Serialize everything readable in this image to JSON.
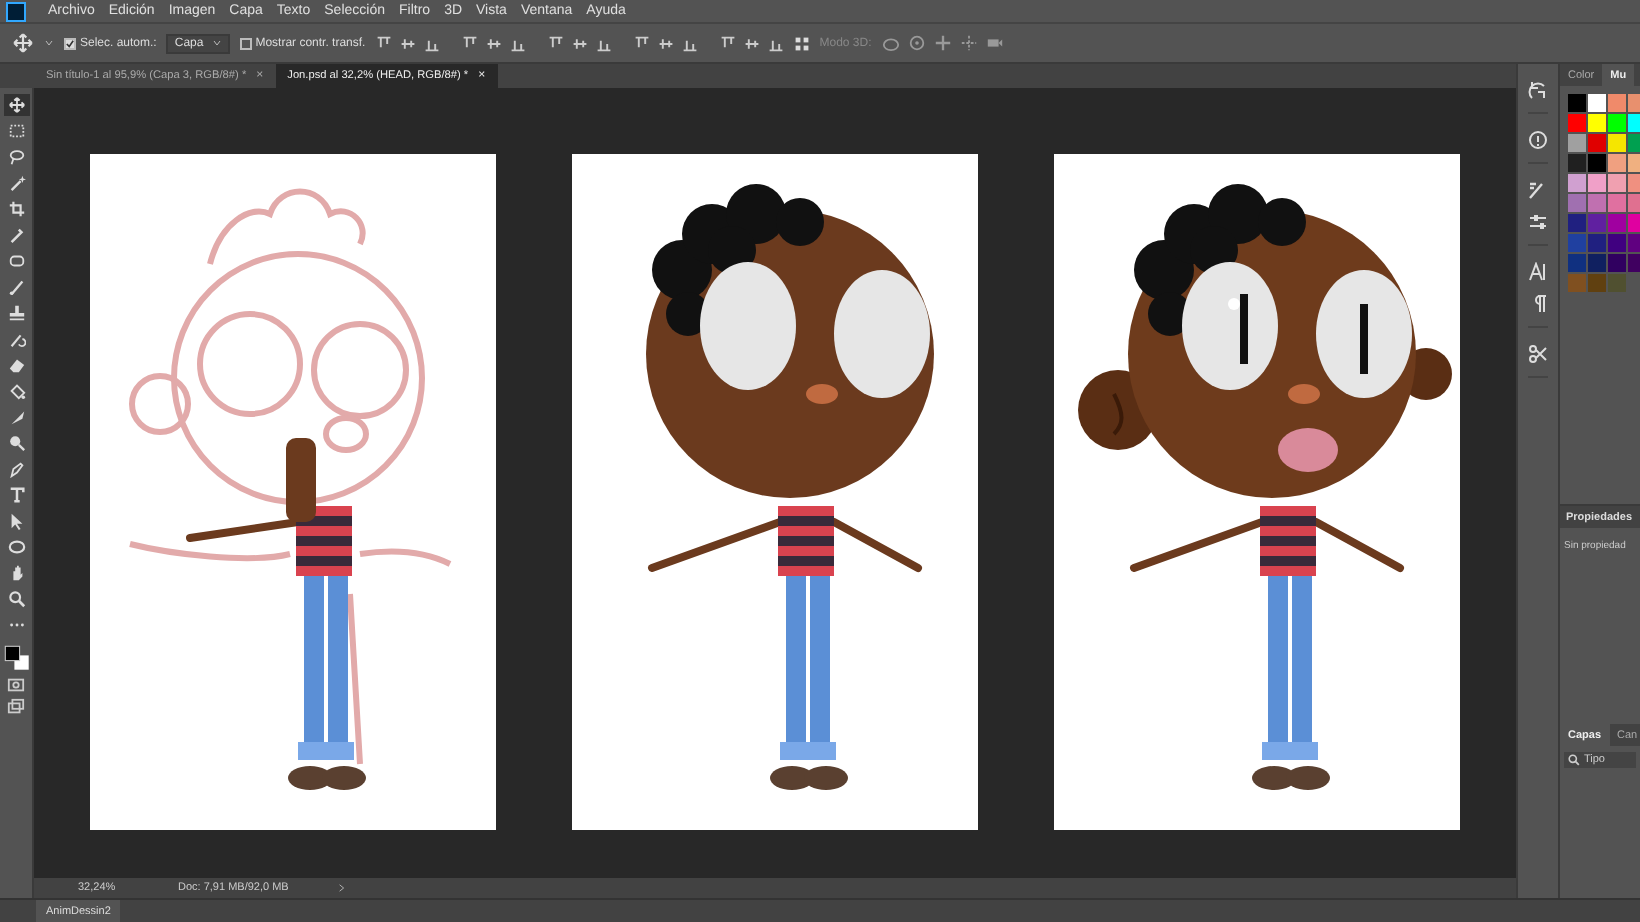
{
  "menu": {
    "items": [
      "Archivo",
      "Edición",
      "Imagen",
      "Capa",
      "Texto",
      "Selección",
      "Filtro",
      "3D",
      "Vista",
      "Ventana",
      "Ayuda"
    ]
  },
  "options_bar": {
    "auto_select": {
      "label": "Selec. autom.:",
      "checked": true
    },
    "target": {
      "value": "Capa"
    },
    "show_transform": {
      "label": "Mostrar contr. transf.",
      "checked": false
    },
    "mode_3d": {
      "label": "Modo 3D:",
      "disabled": true
    }
  },
  "document_tabs": [
    {
      "title": "Sin título-1 al 95,9% (Capa 3, RGB/8#) *",
      "close": "×",
      "selected": false
    },
    {
      "title": "Jon.psd al 32,2% (HEAD, RGB/8#) *",
      "close": "×",
      "selected": true
    }
  ],
  "tools": [
    {
      "kind": "move",
      "selected": true
    },
    {
      "kind": "marquee",
      "selected": false
    },
    {
      "kind": "lasso",
      "selected": false
    },
    {
      "kind": "wand",
      "selected": false
    },
    {
      "kind": "crop",
      "selected": false
    },
    {
      "kind": "eyedropper",
      "selected": false
    },
    {
      "kind": "patch",
      "selected": false
    },
    {
      "kind": "brush",
      "selected": false
    },
    {
      "kind": "stamp",
      "selected": false
    },
    {
      "kind": "history",
      "selected": false
    },
    {
      "kind": "eraser",
      "selected": false
    },
    {
      "kind": "bucket",
      "selected": false
    },
    {
      "kind": "smudge",
      "selected": false
    },
    {
      "kind": "dodge",
      "selected": false
    },
    {
      "kind": "pen",
      "selected": false
    },
    {
      "kind": "type",
      "selected": false
    },
    {
      "kind": "select",
      "selected": false
    },
    {
      "kind": "ellipse",
      "selected": false
    },
    {
      "kind": "hand",
      "selected": false
    },
    {
      "kind": "zoom",
      "selected": false
    },
    {
      "kind": "more",
      "selected": false
    }
  ],
  "artboards": [
    {
      "kind": "sketch"
    },
    {
      "kind": "flat"
    },
    {
      "kind": "shaded"
    }
  ],
  "color_panel": {
    "tabs": [
      {
        "label": "Color",
        "selected": false
      },
      {
        "label": "Mu",
        "selected": true
      }
    ],
    "swatches": [
      {
        "color": "#000000"
      },
      {
        "color": "#ffffff"
      },
      {
        "color": "#f08a6a"
      },
      {
        "color": "#e8906e"
      },
      {
        "color": "#ff0000"
      },
      {
        "color": "#ffff00"
      },
      {
        "color": "#00ff00"
      },
      {
        "color": "#00ffff"
      },
      {
        "color": "#a0a0a0"
      },
      {
        "color": "#e00000"
      },
      {
        "color": "#f5e600"
      },
      {
        "color": "#00a050"
      },
      {
        "color": "#202020"
      },
      {
        "color": "#000000"
      },
      {
        "color": "#f0a080"
      },
      {
        "color": "#f0b080"
      },
      {
        "color": "#d0a0d0"
      },
      {
        "color": "#f0a0c8"
      },
      {
        "color": "#f0a0b0"
      },
      {
        "color": "#f09080"
      },
      {
        "color": "#a070b0"
      },
      {
        "color": "#c070b0"
      },
      {
        "color": "#e070a0"
      },
      {
        "color": "#e07090"
      },
      {
        "color": "#202080"
      },
      {
        "color": "#6020a0"
      },
      {
        "color": "#a000a0"
      },
      {
        "color": "#e000a0"
      },
      {
        "color": "#2040a0"
      },
      {
        "color": "#202080"
      },
      {
        "color": "#400080"
      },
      {
        "color": "#600080"
      },
      {
        "color": "#103080"
      },
      {
        "color": "#102060"
      },
      {
        "color": "#300060"
      },
      {
        "color": "#400060"
      },
      {
        "color": "#805020"
      },
      {
        "color": "#604010"
      },
      {
        "color": "#505030"
      }
    ]
  },
  "properties_panel": {
    "title": "Propiedades",
    "message": "Sin propiedad"
  },
  "layers_panel": {
    "tabs": [
      {
        "label": "Capas",
        "selected": true
      },
      {
        "label": "Can",
        "selected": false
      }
    ],
    "filter_label": "Tipo"
  },
  "status_bar": {
    "zoom": "32,24%",
    "doc_size": "Doc: 7,91 MB/92,0 MB"
  },
  "bottom_panel": {
    "tab": "AnimDessin2"
  }
}
